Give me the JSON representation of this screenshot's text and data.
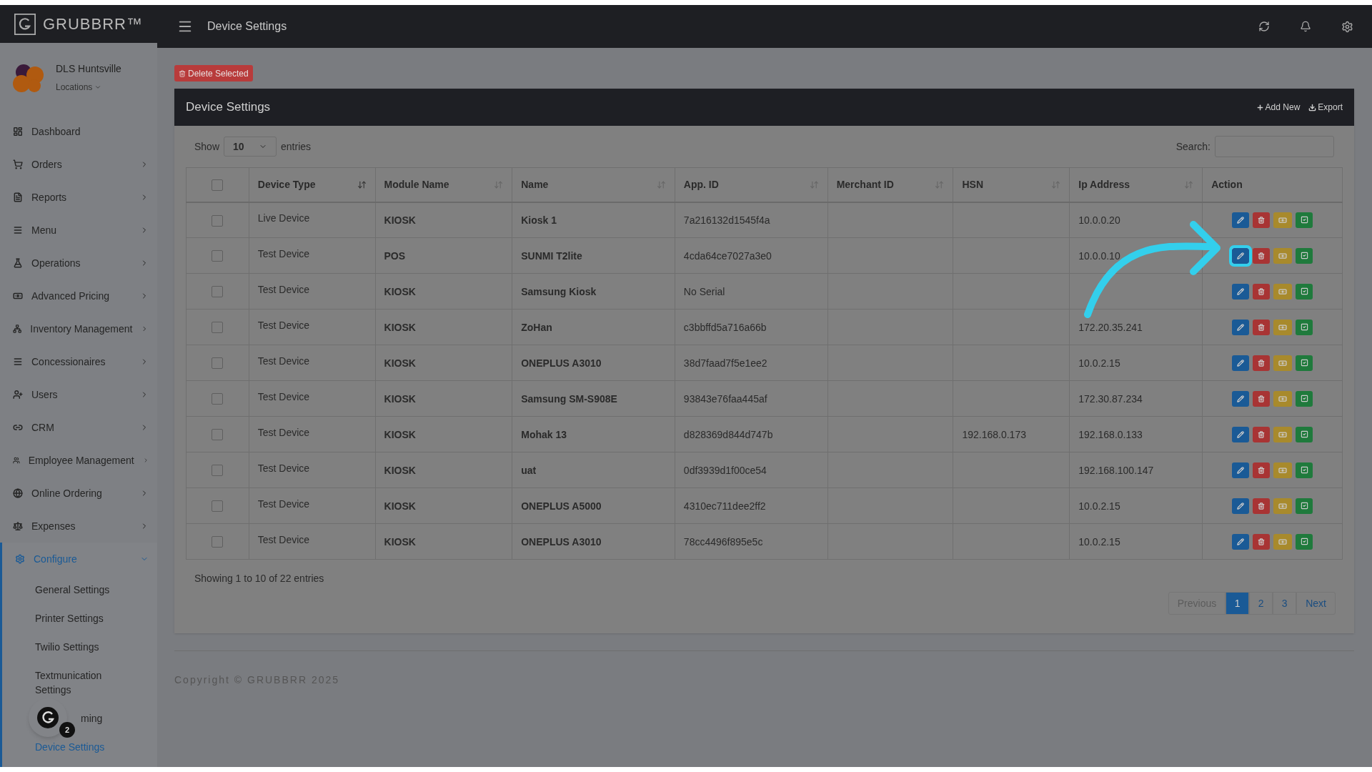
{
  "brand": "GRUBBRR™",
  "topbar": {
    "title": "Device Settings"
  },
  "account": {
    "name": "DLS Huntsville",
    "locations": "Locations"
  },
  "sidebar": {
    "items": [
      {
        "label": "Dashboard",
        "has_children": false,
        "selected": false
      },
      {
        "label": "Orders",
        "has_children": true,
        "expanded": false,
        "selected": false
      },
      {
        "label": "Reports",
        "has_children": true,
        "expanded": false,
        "selected": false
      },
      {
        "label": "Menu",
        "has_children": true,
        "expanded": false,
        "selected": false
      },
      {
        "label": "Operations",
        "has_children": true,
        "expanded": false,
        "selected": false
      },
      {
        "label": "Advanced Pricing",
        "has_children": true,
        "expanded": false,
        "selected": false
      },
      {
        "label": "Inventory Management",
        "has_children": true,
        "expanded": false,
        "selected": false
      },
      {
        "label": "Concessionaires",
        "has_children": true,
        "expanded": false,
        "selected": false
      },
      {
        "label": "Users",
        "has_children": true,
        "expanded": false,
        "selected": false
      },
      {
        "label": "CRM",
        "has_children": true,
        "expanded": false,
        "selected": false
      },
      {
        "label": "Employee Management",
        "has_children": true,
        "expanded": false,
        "selected": false
      },
      {
        "label": "Online Ordering",
        "has_children": true,
        "expanded": false,
        "selected": false
      },
      {
        "label": "Expenses",
        "has_children": true,
        "expanded": false,
        "selected": false
      },
      {
        "label": "Configure",
        "has_children": true,
        "expanded": true,
        "selected": true,
        "children": [
          {
            "label": "General Settings",
            "selected": false
          },
          {
            "label": "Printer Settings",
            "selected": false
          },
          {
            "label": "Twilio Settings",
            "selected": false
          },
          {
            "label": "Textmunication Settings",
            "selected": false
          },
          {
            "label": "ming",
            "selected": false
          },
          {
            "label": "Device Settings",
            "selected": true
          }
        ]
      }
    ]
  },
  "chat_badge": "2",
  "delete_button": "Delete Selected",
  "card": {
    "title": "Device Settings",
    "add_new": "Add New",
    "export": "Export"
  },
  "length": {
    "show": "Show",
    "value": "10",
    "entries": "entries"
  },
  "search": {
    "label": "Search:"
  },
  "table": {
    "select_all": {
      "checked": false
    },
    "columns": [
      {
        "label": "Device Type",
        "sortable": true
      },
      {
        "label": "Module Name",
        "sortable": true
      },
      {
        "label": "Name",
        "sortable": true
      },
      {
        "label": "App. ID",
        "sortable": true
      },
      {
        "label": "Merchant ID",
        "sortable": true
      },
      {
        "label": "HSN",
        "sortable": true
      },
      {
        "label": "Ip Address",
        "sortable": true
      },
      {
        "label": "Action",
        "sortable": false
      }
    ],
    "rows": [
      {
        "checked": false,
        "device_type": "Live Device",
        "module": "KIOSK",
        "name": "Kiosk 1",
        "app_id": "7a216132d1545f4a",
        "merchant_id": "",
        "hsn": "",
        "ip": "10.0.0.20",
        "edit_highlighted": false
      },
      {
        "checked": false,
        "device_type": "Test Device",
        "module": "POS",
        "name": "SUNMI T2lite",
        "app_id": "4cda64ce7027a3e0",
        "merchant_id": "",
        "hsn": "",
        "ip": "10.0.0.10",
        "edit_highlighted": true
      },
      {
        "checked": false,
        "device_type": "Test Device",
        "module": "KIOSK",
        "name": "Samsung Kiosk",
        "app_id": "No Serial",
        "merchant_id": "",
        "hsn": "",
        "ip": "",
        "edit_highlighted": false
      },
      {
        "checked": false,
        "device_type": "Test Device",
        "module": "KIOSK",
        "name": "ZoHan",
        "app_id": "c3bbffd5a716a66b",
        "merchant_id": "",
        "hsn": "",
        "ip": "172.20.35.241",
        "edit_highlighted": false
      },
      {
        "checked": false,
        "device_type": "Test Device",
        "module": "KIOSK",
        "name": "ONEPLUS A3010",
        "app_id": "38d7faad7f5e1ee2",
        "merchant_id": "",
        "hsn": "",
        "ip": "10.0.2.15",
        "edit_highlighted": false
      },
      {
        "checked": false,
        "device_type": "Test Device",
        "module": "KIOSK",
        "name": "Samsung SM-S908E",
        "app_id": "93843e76faa445af",
        "merchant_id": "",
        "hsn": "",
        "ip": "172.30.87.234",
        "edit_highlighted": false
      },
      {
        "checked": false,
        "device_type": "Test Device",
        "module": "KIOSK",
        "name": "Mohak 13",
        "app_id": "d828369d844d747b",
        "merchant_id": "",
        "hsn": "192.168.0.173",
        "ip": "192.168.0.133",
        "edit_highlighted": false
      },
      {
        "checked": false,
        "device_type": "Test Device",
        "module": "KIOSK",
        "name": "uat",
        "app_id": "0df3939d1f00ce54",
        "merchant_id": "",
        "hsn": "",
        "ip": "192.168.100.147",
        "edit_highlighted": false
      },
      {
        "checked": false,
        "device_type": "Test Device",
        "module": "KIOSK",
        "name": "ONEPLUS A5000",
        "app_id": "4310ec711dee2ff2",
        "merchant_id": "",
        "hsn": "",
        "ip": "10.0.2.15",
        "edit_highlighted": false
      },
      {
        "checked": false,
        "device_type": "Test Device",
        "module": "KIOSK",
        "name": "ONEPLUS A3010",
        "app_id": "78cc4496f895e5c",
        "merchant_id": "",
        "hsn": "",
        "ip": "10.0.2.15",
        "edit_highlighted": false
      }
    ]
  },
  "info": "Showing 1 to 10 of 22 entries",
  "pagination": {
    "previous": "Previous",
    "next": "Next",
    "pages": [
      {
        "label": "1",
        "selected": true
      },
      {
        "label": "2",
        "selected": false
      },
      {
        "label": "3",
        "selected": false
      }
    ]
  },
  "footer": "Copyright © GRUBBRR 2025"
}
